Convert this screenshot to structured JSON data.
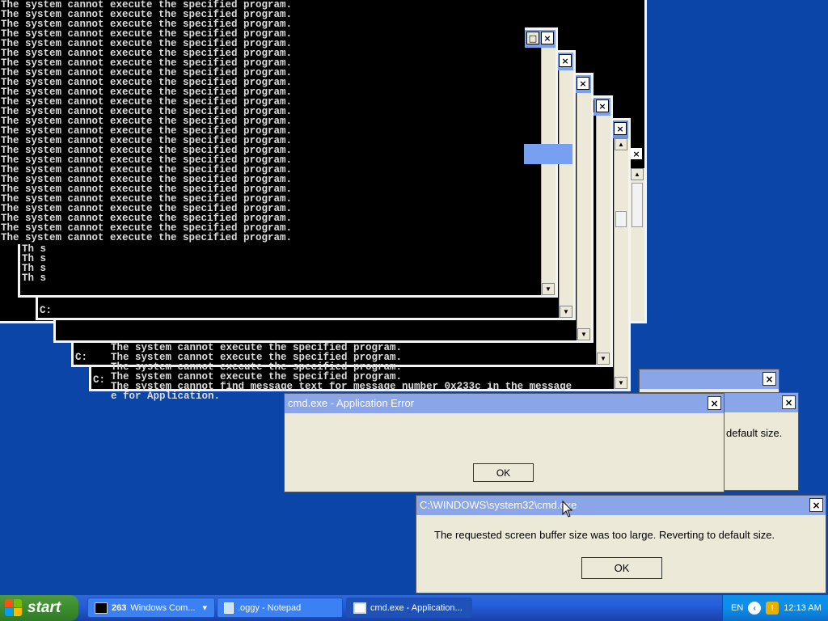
{
  "console": {
    "repeated_line": "The system cannot execute the specified program.",
    "line_count": 25
  },
  "fragments": {
    "left_column": [
      "Th s",
      "Th s",
      "Th s",
      "Th s"
    ],
    "prompt_c1": "C:",
    "prompt_c2": "C:",
    "prompt_c3": "C:",
    "mid_line_1": "The system cannot execute the specified program.",
    "mid_line_2": "The system cannot execute the specified program.",
    "mid_line_3": "The system cannot execute the specified program.",
    "mid_line_4": "The system cannot execute the specified program.",
    "mid_line_5": "The system cannot find message text for message number 0x233c in the message",
    "mid_line_6": "e for Application."
  },
  "win_controls": {
    "minimize": "_",
    "maximize": "□",
    "close": "×",
    "up": "▲",
    "down": "▼"
  },
  "app_error": {
    "title": "cmd.exe - Application Error",
    "ok": "OK"
  },
  "behind_dialog": {
    "partial_text": "default size."
  },
  "buffer_dialog": {
    "title": "C:\\WINDOWS\\system32\\cmd.exe",
    "message": "The requested screen buffer size was too large. Reverting to default size.",
    "ok": "OK"
  },
  "taskbar": {
    "start": "start",
    "items": [
      {
        "count": "263",
        "label": "Windows Com...",
        "arrow": "▾"
      },
      {
        "label": ".oggy - Notepad"
      },
      {
        "label": "cmd.exe - Application..."
      }
    ],
    "language": "EN",
    "clock": "12:13 AM"
  },
  "colors": {
    "desktop": "#0b45a8",
    "taskbar": "#245edb",
    "start": "#3c8d2f",
    "dialog_bg": "#ece9d8",
    "title_inactive": "#8aa5e8"
  }
}
